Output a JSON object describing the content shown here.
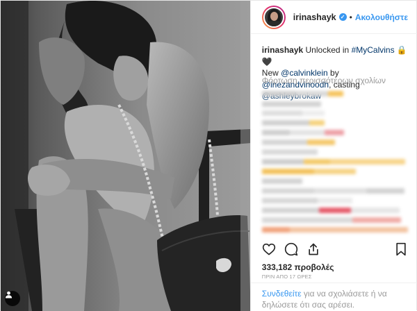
{
  "header": {
    "username": "irinashayk",
    "verified_icon": "verified-badge-icon",
    "separator": "•",
    "follow_label": "Ακολουθήστε"
  },
  "caption": {
    "username": "irinashayk",
    "text_1": "Unlocked in ",
    "hashtag": "#MyCalvins",
    "emoji": "🔒🖤",
    "text_2": "New ",
    "mention_1": "@calvinklein",
    "text_3": " by ",
    "mention_2": "@inezandvinoodh",
    "text_4": ", casting ",
    "mention_3": "@ashleybrokaw"
  },
  "load_more_label": "Φόρτωση περισσότερων σχολίων",
  "likes_label": "333,182 προβολές",
  "timestamp": "ΠΡΙΝ ΑΠΟ 17 ΩΡΕΣ",
  "footer": {
    "login_link": "Συνδεθείτε",
    "rest_text": " για να σχολιάσετε ή να δηλώσετε ότι σας αρέσει."
  },
  "icons": {
    "like": "heart-icon",
    "comment": "comment-icon",
    "share": "share-icon",
    "save": "bookmark-icon",
    "user_tag": "user-tag-icon"
  },
  "colors": {
    "link_blue": "#3897f0",
    "tag_blue": "#003569",
    "muted": "#999999",
    "text": "#262626"
  }
}
